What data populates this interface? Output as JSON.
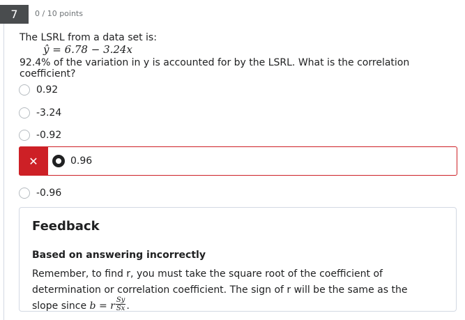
{
  "question": {
    "number": "7",
    "points": "0 / 10 points",
    "stem_line1": "The LSRL from a data set is:",
    "formula": "ŷ = 6.78 − 3.24x",
    "stem_line2": "92.4% of the variation in y is accounted for by the LSRL. What is the correlation coefficient?"
  },
  "options": [
    {
      "label": "0.92",
      "selected": false
    },
    {
      "label": "-3.24",
      "selected": false
    },
    {
      "label": "-0.92",
      "selected": false
    },
    {
      "label": "0.96",
      "selected": true,
      "status": "incorrect"
    },
    {
      "label": "-0.96",
      "selected": false
    }
  ],
  "icons": {
    "incorrect": "close-icon"
  },
  "colors": {
    "incorrect": "#cd2026",
    "question_number_bg": "#494c4e"
  },
  "feedback": {
    "title": "Feedback",
    "subtitle": "Based on answering incorrectly",
    "text_part1": "Remember, to find r, you must take the square root of the coefficient of determination or correlation coefficient. The sign of r will be the same as the slope since",
    "formula_lhs": "b = r",
    "formula_num": "Sy",
    "formula_den": "Sx",
    "text_end": "."
  }
}
